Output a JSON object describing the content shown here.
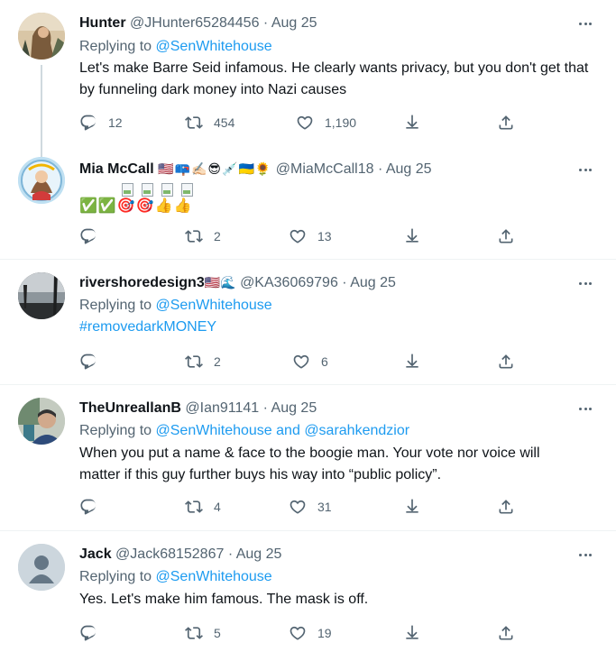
{
  "tweets": [
    {
      "name": "Hunter",
      "handle": "@JHunter65284456",
      "date": "Aug 25",
      "replying_to_prefix": "Replying to",
      "replying_to": "@SenWhitehouse",
      "text": "Let's make Barre Seid infamous. He clearly wants privacy, but you don't get that by funneling dark money into Nazi causes",
      "replies": "12",
      "retweets": "454",
      "likes": "1,190"
    },
    {
      "name": "Mia McCall",
      "name_emoji": "🇺🇸📪✍🏻😎💉🇺🇦🌻",
      "handle": "@MiaMcCall18",
      "date": "Aug 25",
      "text": "✅✅🎯🎯👍👍",
      "replies": "",
      "retweets": "2",
      "likes": "13"
    },
    {
      "name": "rivershoredesign3",
      "name_emoji": "🇺🇸🌊",
      "handle": "@KA36069796",
      "date": "Aug 25",
      "replying_to_prefix": "Replying to",
      "replying_to": "@SenWhitehouse",
      "text": "#removedarkMONEY",
      "replies": "",
      "retweets": "2",
      "likes": "6"
    },
    {
      "name": "TheUnreallanB",
      "handle": "@Ian91141",
      "date": "Aug 25",
      "replying_to_prefix": "Replying to",
      "replying_to": "@SenWhitehouse",
      "replying_and": "and",
      "replying_to_2": "@sarahkendzior",
      "text_line1": "When you put a name & face to the boogie man. Your vote nor voice will",
      "text_line2": "matter if this guy further buys his way into “public policy”.",
      "replies": "",
      "retweets": "4",
      "likes": "31"
    },
    {
      "name": "Jack",
      "handle": "@Jack68152867",
      "date": "Aug 25",
      "replying_to_prefix": "Replying to",
      "replying_to": "@SenWhitehouse",
      "text": "Yes. Let's make him famous. The mask is off.",
      "replies": "",
      "retweets": "5",
      "likes": "19"
    }
  ],
  "dot": "·",
  "icons": [
    "reply-icon",
    "retweet-icon",
    "like-icon",
    "download-icon",
    "share-icon",
    "more-icon"
  ],
  "colors": {
    "link": "#1d9bf0",
    "muted": "#536471",
    "separator": "#eff3f4"
  }
}
